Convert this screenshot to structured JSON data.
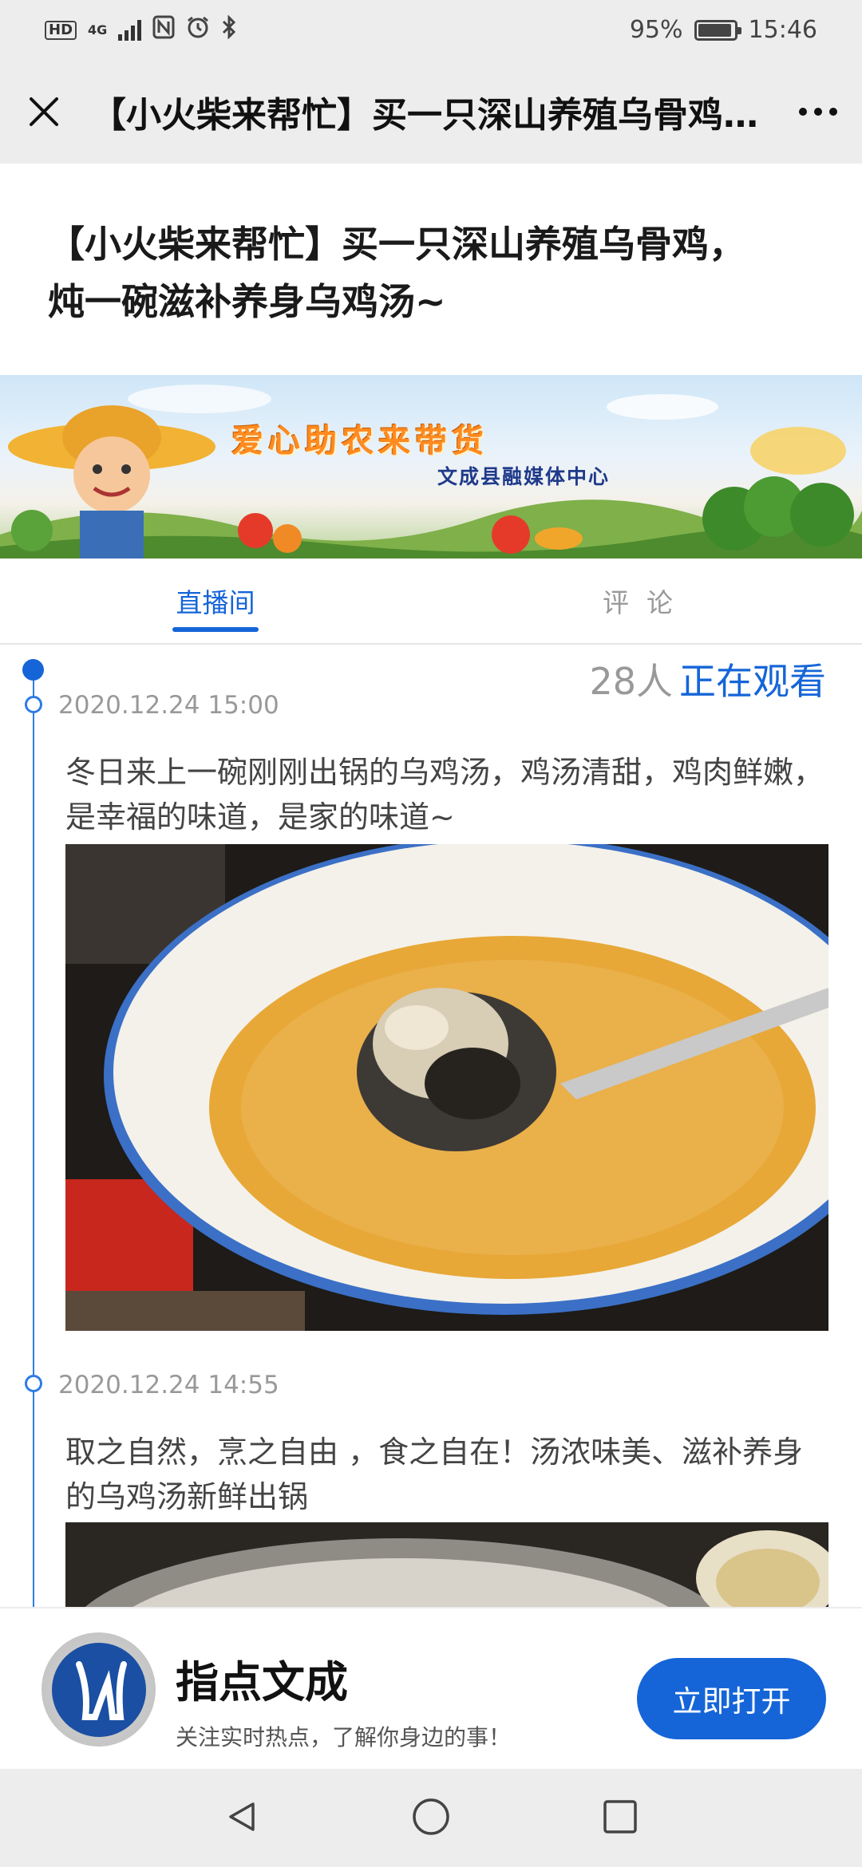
{
  "status_bar": {
    "hd": "HD",
    "network": "4G",
    "battery_percent": "95%",
    "battery_level": 0.95,
    "time": "15:46",
    "icons": [
      "hd-icon",
      "signal-icon",
      "nfc-icon",
      "alarm-icon",
      "bluetooth-icon",
      "battery-icon"
    ]
  },
  "title_bar": {
    "title": "【小火柴来帮忙】买一只深山养殖乌骨鸡，炖一碗滋补养身乌鸡汤~",
    "icons": [
      "close-icon",
      "more-icon"
    ]
  },
  "article": {
    "headline": "【小火柴来帮忙】买一只深山养殖乌骨鸡，炖一碗滋补养身乌鸡汤~"
  },
  "banner": {
    "title": "爱心助农来带货",
    "subtitle": "文成县融媒体中心"
  },
  "tabs": [
    {
      "label": "直播间",
      "active": true
    },
    {
      "label": "评论",
      "active": false
    }
  ],
  "live": {
    "viewer_count": "28人",
    "viewer_label": "正在观看"
  },
  "posts": [
    {
      "time": "2020.12.24 15:00",
      "text": "冬日来上一碗刚刚出锅的乌鸡汤，鸡汤清甜，鸡肉鲜嫩，是幸福的味道，是家的味道~",
      "photo": "bowl-of-black-chicken-soup"
    },
    {
      "time": "2020.12.24 14:55",
      "text": "取之自然，烹之自由 ，食之自在！汤浓味美、滋补养身的乌鸡汤新鲜出锅",
      "photo": "pot-of-steaming-soup"
    }
  ],
  "promo": {
    "app_name": "指点文成",
    "slogan": "关注实时热点，了解你身边的事！",
    "button_label": "立即打开"
  },
  "nav_bar": {
    "icons": [
      "back-icon",
      "home-icon",
      "recents-icon"
    ]
  },
  "colors": {
    "accent": "#1565d8",
    "status_bar_bg": "#ededed",
    "muted_text": "#999999"
  }
}
